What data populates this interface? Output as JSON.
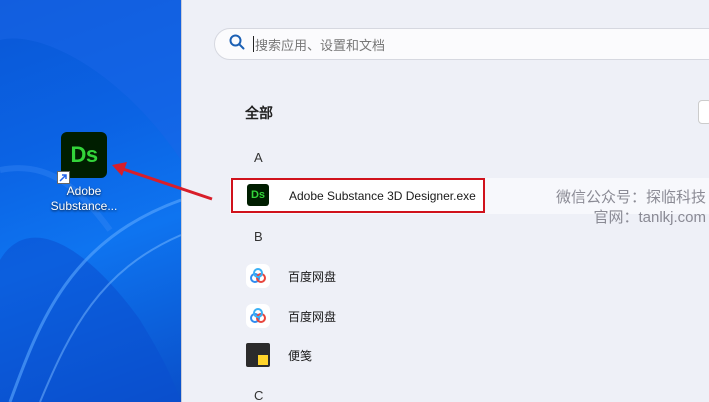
{
  "desktop": {
    "icon_text": "Ds",
    "icon_label": "Adobe Substance..."
  },
  "search": {
    "placeholder": "搜索应用、设置和文档"
  },
  "section_title": "全部",
  "letters": [
    "A",
    "B",
    "C"
  ],
  "apps": [
    {
      "label": "Adobe Substance 3D Designer.exe",
      "icon": "ds-icon",
      "icon_text": "Ds"
    },
    {
      "label": "百度网盘",
      "icon": "baidu-netdisk-icon"
    },
    {
      "label": "百度网盘",
      "icon": "baidu-netdisk-icon"
    },
    {
      "label": "便笺",
      "icon": "sticky-notes-icon"
    }
  ],
  "watermark": {
    "line1": "微信公众号：探临科技",
    "line2": "官网：tanlkj.com"
  },
  "colors": {
    "highlight": "#d0121c",
    "ds_green": "#33d43a",
    "ds_bg": "#001e00"
  }
}
